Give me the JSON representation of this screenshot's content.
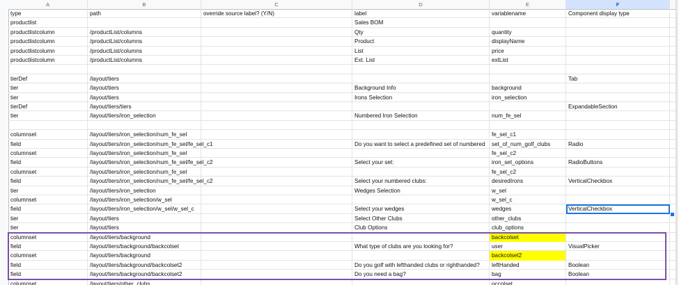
{
  "columns": [
    "A",
    "B",
    "C",
    "D",
    "E",
    "F"
  ],
  "rows": [
    [
      "type",
      "path",
      "override source label? (Y/N)",
      "label",
      "variablename",
      "Component display type"
    ],
    [
      "productlist",
      "",
      "",
      "Sales BOM",
      "",
      ""
    ],
    [
      "productlistcolumn",
      "/productList/columns",
      "",
      "Qty",
      "quantity",
      ""
    ],
    [
      "productlistcolumn",
      "/productList/columns",
      "",
      "Product",
      "displayName",
      ""
    ],
    [
      "productlistcolumn",
      "/productList/columns",
      "",
      "List",
      "price",
      ""
    ],
    [
      "productlistcolumn",
      "/productList/columns",
      "",
      "Ext. List",
      "extList",
      ""
    ],
    [
      "",
      "",
      "",
      "",
      "",
      ""
    ],
    [
      "tierDef",
      "/layout/tiers",
      "",
      "",
      "",
      "Tab"
    ],
    [
      "tier",
      "/layout/tiers",
      "",
      "Background Info",
      "background",
      ""
    ],
    [
      "tier",
      "/layout/tiers",
      "",
      "Irons Selection",
      "iron_selection",
      ""
    ],
    [
      "tierDef",
      "/layout/tiers/tiers",
      "",
      "",
      "",
      "ExpandableSection"
    ],
    [
      "tier",
      "/layout/tiers/iron_selection",
      "",
      "Numbered Iron Selection",
      "num_fe_sel",
      ""
    ],
    [
      "",
      "",
      "",
      "",
      "",
      ""
    ],
    [
      "columnset",
      "/layout/tiers/iron_selection/num_fe_sel",
      "",
      "",
      "fe_sel_c1",
      ""
    ],
    [
      "field",
      "/layout/tiers/iron_selection/num_fe_sel/fe_sel_c1",
      "",
      "Do you want to select a predefined set of numbered",
      "set_of_num_golf_clubs",
      "Radio"
    ],
    [
      "columnset",
      "/layout/tiers/iron_selection/num_fe_sel",
      "",
      "",
      "fe_sel_c2",
      ""
    ],
    [
      "field",
      "/layout/tiers/iron_selection/num_fe_sel/fe_sel_c2",
      "",
      "Select your set:",
      "iron_set_options",
      "RadioButtons"
    ],
    [
      "columnset",
      "/layout/tiers/iron_selection/num_fe_sel",
      "",
      "",
      "fe_sel_c2",
      ""
    ],
    [
      "field",
      "/layout/tiers/iron_selection/num_fe_sel/fe_sel_c2",
      "",
      "Select your numbered clubs:",
      "desiredIrons",
      "VerticalCheckbox"
    ],
    [
      "tier",
      "/layout/tiers/iron_selection",
      "",
      "Wedges Selection",
      "w_sel",
      ""
    ],
    [
      "columnset",
      "/layout/tiers/iron_selection/w_sel",
      "",
      "",
      "w_sel_c",
      ""
    ],
    [
      "field",
      "/layout/tiers/iron_selection/w_sel/w_sel_c",
      "",
      "Select your wedges",
      "wedges",
      "VerticalCheckbox"
    ],
    [
      "tier",
      "/layout/tiers",
      "",
      "Select Other Clubs",
      "other_clubs",
      ""
    ],
    [
      "tier",
      "/layout/tiers",
      "",
      "Club Options",
      "club_options",
      ""
    ],
    [
      "columnset",
      "/layout/tiers/background",
      "",
      "",
      "backcolset",
      ""
    ],
    [
      "field",
      "/layout/tiers/background/backcolset",
      "",
      "What type of clubs are you looking for?",
      "user",
      "VisualPicker"
    ],
    [
      "columnset",
      "/layout/tiers/background",
      "",
      "",
      "backcolset2",
      ""
    ],
    [
      "field",
      "/layout/tiers/background/backcolset2",
      "",
      "Do you golf with lefthanded clubs or righthanded?",
      "leftHanded",
      "Boolean"
    ],
    [
      "field",
      "/layout/tiers/background/backcolset2",
      "",
      "Do you need a bag?",
      "bag",
      "Boolean"
    ],
    [
      "columnset",
      "/layout/tiers/other_clubs",
      "",
      "",
      "occolset",
      ""
    ]
  ],
  "highlight_color": "#ffff00",
  "selection_border_color": "#7b4fa8",
  "active_cell_color": "#1a73e8"
}
